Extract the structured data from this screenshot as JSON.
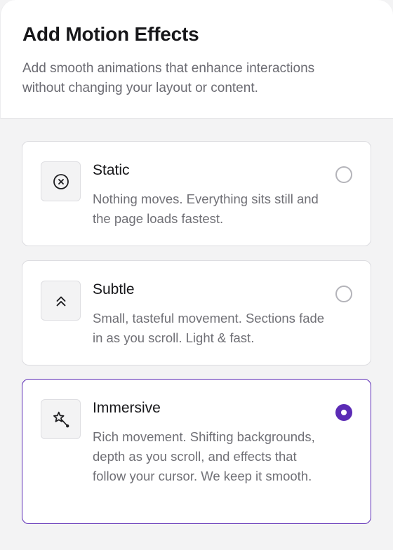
{
  "header": {
    "title": "Add Motion Effects",
    "subtitle": "Add smooth animations that enhance interactions without changing your layout or content."
  },
  "options": [
    {
      "icon": "circle-x-icon",
      "title": "Static",
      "description": "Nothing moves. Everything sits still and the page loads fastest.",
      "selected": false
    },
    {
      "icon": "double-chevron-up-icon",
      "title": "Subtle",
      "description": "Small, tasteful movement. Sections fade in as you scroll. Light & fast.",
      "selected": false
    },
    {
      "icon": "magic-wand-icon",
      "title": "Immersive",
      "description": "Rich movement. Shifting backgrounds, depth as you scroll, and effects that follow your cursor. We keep it smooth.",
      "selected": true
    }
  ],
  "colors": {
    "accent": "#5b2bb5",
    "background": "#f3f3f4",
    "title_text": "#17171a",
    "muted_text": "#6b6b72"
  }
}
